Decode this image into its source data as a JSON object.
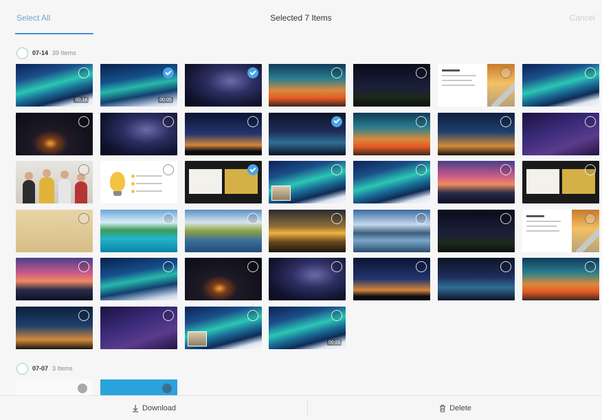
{
  "header": {
    "select_all_label": "Select All",
    "title": "Selected 7 Items",
    "cancel_label": "Cancel"
  },
  "groups": [
    {
      "date": "07-14",
      "count_label": "39 Items"
    },
    {
      "date": "07-07",
      "count_label": "3 Items"
    }
  ],
  "tiles": [
    {
      "kind": "aurora",
      "selected": false,
      "duration": "00:14"
    },
    {
      "kind": "aurora2",
      "selected": true,
      "duration": "00:05"
    },
    {
      "kind": "galaxy",
      "selected": true,
      "duration": ""
    },
    {
      "kind": "sunset-sky",
      "selected": false,
      "duration": ""
    },
    {
      "kind": "night-ground",
      "selected": false,
      "duration": ""
    },
    {
      "kind": "doc",
      "selected": false,
      "duration": ""
    },
    {
      "kind": "aurora",
      "selected": false,
      "duration": ""
    },
    {
      "kind": "night-fire",
      "selected": false,
      "duration": ""
    },
    {
      "kind": "galaxy",
      "selected": false,
      "duration": ""
    },
    {
      "kind": "mountain-night",
      "selected": false,
      "duration": ""
    },
    {
      "kind": "ocean-dusk",
      "selected": true,
      "duration": ""
    },
    {
      "kind": "sunset-sky",
      "selected": false,
      "duration": ""
    },
    {
      "kind": "tree",
      "selected": false,
      "duration": ""
    },
    {
      "kind": "purple",
      "selected": false,
      "duration": ""
    },
    {
      "kind": "people",
      "selected": false,
      "duration": ""
    },
    {
      "kind": "bulb-slide",
      "selected": false,
      "duration": ""
    },
    {
      "kind": "slide-dark",
      "selected": true,
      "duration": ""
    },
    {
      "kind": "aurora-inset",
      "selected": false,
      "duration": ""
    },
    {
      "kind": "aurora",
      "selected": false,
      "duration": ""
    },
    {
      "kind": "pink-sunset",
      "selected": false,
      "duration": ""
    },
    {
      "kind": "slide-dark2",
      "selected": false,
      "duration": ""
    },
    {
      "kind": "paper",
      "selected": false,
      "duration": ""
    },
    {
      "kind": "beach",
      "selected": false,
      "duration": ""
    },
    {
      "kind": "lake",
      "selected": false,
      "duration": ""
    },
    {
      "kind": "golden",
      "selected": false,
      "duration": ""
    },
    {
      "kind": "mountain-lake",
      "selected": false,
      "duration": ""
    },
    {
      "kind": "night-ground",
      "selected": false,
      "duration": ""
    },
    {
      "kind": "doc",
      "selected": false,
      "duration": ""
    },
    {
      "kind": "pink-sunset",
      "selected": false,
      "duration": ""
    },
    {
      "kind": "aurora2",
      "selected": false,
      "duration": ""
    },
    {
      "kind": "night-fire",
      "selected": false,
      "duration": ""
    },
    {
      "kind": "galaxy",
      "selected": false,
      "duration": ""
    },
    {
      "kind": "mountain-night",
      "selected": false,
      "duration": ""
    },
    {
      "kind": "ocean-dusk",
      "selected": false,
      "duration": ""
    },
    {
      "kind": "sunset-sky",
      "selected": false,
      "duration": ""
    },
    {
      "kind": "tree",
      "selected": false,
      "duration": ""
    },
    {
      "kind": "purple",
      "selected": false,
      "duration": ""
    },
    {
      "kind": "aurora-inset",
      "selected": false,
      "duration": ""
    },
    {
      "kind": "aurora",
      "selected": false,
      "duration": "00:05"
    }
  ],
  "selection_color": "#4aa3e6",
  "accent_color": "#4a8fd1",
  "footer": {
    "download_label": "Download",
    "delete_label": "Delete",
    "download_icon": "download-arrow-icon",
    "delete_icon": "trash-icon"
  }
}
